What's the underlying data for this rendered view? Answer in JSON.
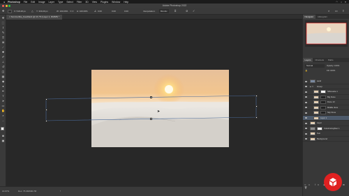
{
  "menubar": {
    "app": "Photoshop",
    "items": [
      "File",
      "Edit",
      "Image",
      "Layer",
      "Type",
      "Select",
      "Filter",
      "3D",
      "View",
      "Plugins",
      "Window",
      "Help"
    ]
  },
  "window": {
    "title": "Adobe Photoshop 2022"
  },
  "options": {
    "x_value": "X: 518.28 px",
    "y_value": "Y: 330.29 px",
    "w_value": "W: 100.00%",
    "h_value": "H: 100.00%",
    "angle_value": "0.00",
    "h_skew": "0.00",
    "v_skew": "0.00",
    "interpolation_label": "Interpolation:",
    "interpolation_value": "Bicubic"
  },
  "document": {
    "tab_label": "Sommerlike_Feedback @ 16.7% (Layer 1, RGB/8) *"
  },
  "status": {
    "zoom": "16.67%",
    "size": "Doc: 75.0M/690.7M"
  },
  "panels": {
    "top_tabs": [
      "Navigator",
      "Histogram"
    ],
    "layer_tabs": [
      "Layers",
      "Channels",
      "Paths"
    ],
    "kind_label": "Normal",
    "opacity_label": "Opacity: 100%",
    "fill_label": "Fill: 100%",
    "layers": [
      {
        "name": "sand",
        "type": "plain"
      },
      {
        "name": "Group",
        "type": "group"
      },
      {
        "name": "Silhouette 1",
        "type": "mask"
      },
      {
        "name": "Big Dune",
        "type": "mask"
      },
      {
        "name": "Dune 13",
        "type": "mask"
      },
      {
        "name": "Middle dune",
        "type": "mask"
      },
      {
        "name": "Sky Dune",
        "type": "mask"
      },
      {
        "name": "Layer 1",
        "type": "plain",
        "selected": true
      },
      {
        "name": "Layer",
        "type": "plain"
      },
      {
        "name": "Colorize/Lighten 1",
        "type": "mask"
      },
      {
        "name": "Sun",
        "type": "plain"
      },
      {
        "name": "Background",
        "type": "plain"
      }
    ]
  },
  "colors": {
    "accent_red": "#e02121",
    "selection": "#4d5a6a"
  }
}
